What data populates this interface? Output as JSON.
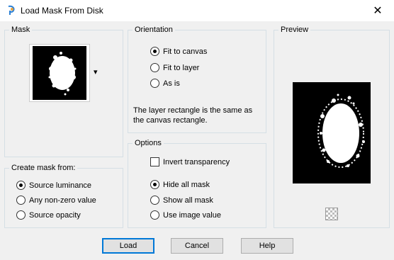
{
  "window": {
    "title": "Load Mask From Disk",
    "close_glyph": "✕"
  },
  "mask": {
    "label": "Mask",
    "dropdown_glyph": "▾"
  },
  "orientation": {
    "label": "Orientation",
    "options": [
      "Fit to canvas",
      "Fit to layer",
      "As is"
    ],
    "selected": "Fit to canvas",
    "description": "The layer rectangle is the same as the canvas rectangle."
  },
  "options": {
    "label": "Options",
    "invert_transparency_label": "Invert transparency",
    "invert_transparency_checked": false,
    "mask_options": [
      "Hide all mask",
      "Show all mask",
      "Use image value"
    ],
    "selected": "Hide all mask"
  },
  "preview": {
    "label": "Preview"
  },
  "create_mask": {
    "label": "Create mask from:",
    "options": [
      "Source luminance",
      "Any non-zero value",
      "Source opacity"
    ],
    "selected": "Source luminance"
  },
  "buttons": {
    "load": "Load",
    "cancel": "Cancel",
    "help": "Help"
  }
}
